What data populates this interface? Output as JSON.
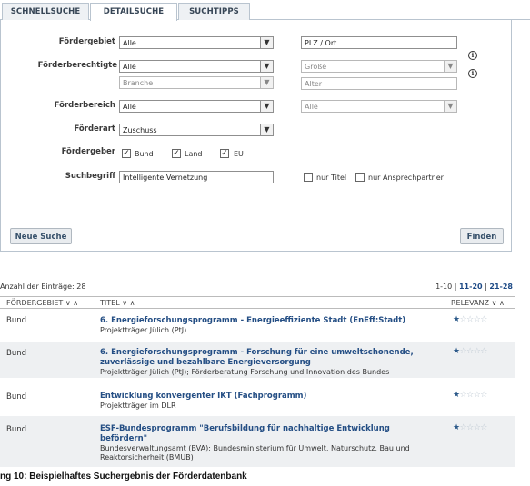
{
  "tabs": [
    "SCHNELLSUCHE",
    "DETAILSUCHE",
    "SUCHTIPPS"
  ],
  "form": {
    "foerdergebiet_label": "Fördergebiet",
    "foerdergebiet_value": "Alle",
    "plz_placeholder": "PLZ / Ort",
    "foerderberechtigte_label": "Förderberechtigte",
    "foerderberechtigte_value": "Alle",
    "groesse_value": "Größe",
    "branche_value": "Branche",
    "alter_value": "Alter",
    "foerderbereich_label": "Förderbereich",
    "foerderbereich_value": "Alle",
    "foerderbereich2_value": "Alle",
    "foerderart_label": "Förderart",
    "foerderart_value": "Zuschuss",
    "foerdergeber_label": "Fördergeber",
    "foerdergeber_options": [
      "Bund",
      "Land",
      "EU"
    ],
    "suchbegriff_label": "Suchbegriff",
    "suchbegriff_value": "Intelligente Vernetzung",
    "nur_titel": "nur Titel",
    "nur_ansprechpartner": "nur Ansprechpartner",
    "info_glyph": "i"
  },
  "buttons": {
    "neue_suche": "Neue Suche",
    "finden": "Finden"
  },
  "results": {
    "count_text": "Anzahl der Einträge: 28",
    "pager": {
      "p1": "1-10",
      "sep1": "|",
      "p2": "11-20",
      "sep2": "|",
      "p3": "21-28"
    },
    "col_foerdergebiet": "FÖRDERGEBIET ∨ ∧",
    "col_titel": "TITEL ∨ ∧",
    "col_relevanz": "RELEVANZ ∨ ∧",
    "rows": [
      {
        "gebiet": "Bund",
        "title": "6. Energieforschungsprogramm - Energieeffiziente Stadt (EnEff:Stadt)",
        "sub": "Projektträger Jülich (PtJ)",
        "stars": 1
      },
      {
        "gebiet": "Bund",
        "title": "6. Energieforschungsprogramm - Forschung für eine umweltschonende, zuverlässige und bezahlbare Energieversorgung",
        "sub": "Projektträger Jülich (PtJ); Förderberatung Forschung und Innovation des Bundes",
        "stars": 1
      },
      {
        "gebiet": "Bund",
        "title": "Entwicklung konvergenter IKT (Fachprogramm)",
        "sub": "Projektträger im DLR",
        "stars": 1
      },
      {
        "gebiet": "Bund",
        "title": "ESF-Bundesprogramm \"Berufsbildung für nachhaltige Entwicklung befördern\"",
        "sub": "Bundesverwaltungsamt (BVA); Bundesministerium für Umwelt, Naturschutz, Bau und Reaktorsicherheit (BMUB)",
        "stars": 1
      }
    ]
  },
  "caption": "ng 10: Beispielhaftes Suchergebnis der Förderdatenbank",
  "colors": {
    "tab_border": "#b9c4cf",
    "link_blue": "#244e84",
    "star_on": "#2d5a8a",
    "row_alt": "#eef0f2"
  }
}
